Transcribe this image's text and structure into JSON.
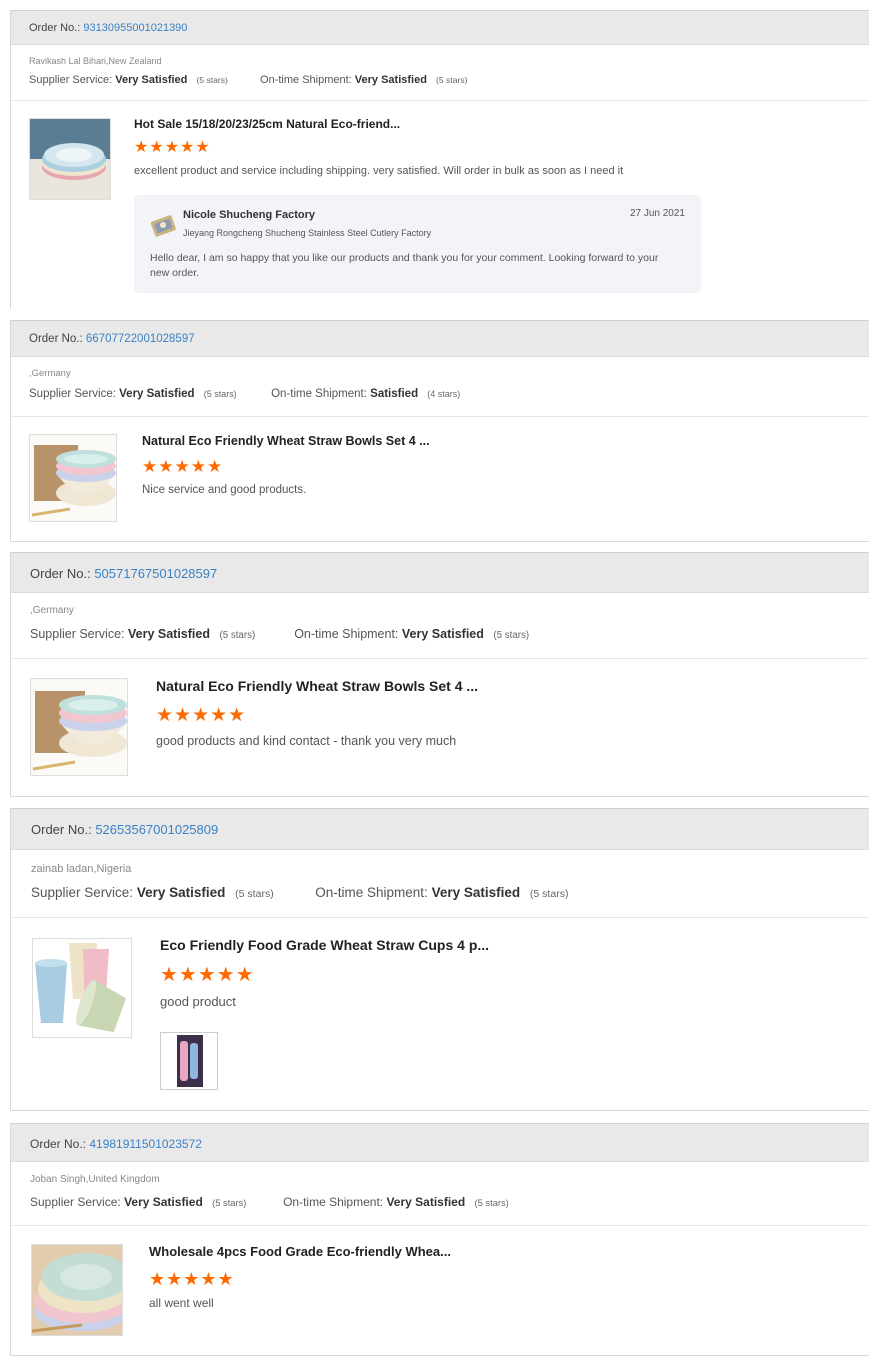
{
  "labels": {
    "order_no": "Order No.:",
    "supplier_service": "Supplier Service:",
    "shipment": "On-time Shipment:"
  },
  "colors": {
    "accent_link": "#3b82c4",
    "star": "#ff6a00",
    "header_bg": "#e9e9e9"
  },
  "orders": [
    {
      "order_no": "93130955001021390",
      "location": "Ravikash Lal Bihari,New Zealand",
      "supplier_rating": "Very Satisfied",
      "supplier_stars": "(5 stars)",
      "shipment_rating": "Very Satisfied",
      "shipment_stars": "(5 stars)",
      "product_title": "Hot Sale 15/18/20/23/25cm Natural Eco-friend...",
      "stars": "★★★★★",
      "rating": 5,
      "comment": "excellent product and service including shipping.  very satisfied. Will order in bulk as soon as I need it",
      "thumb_icon": "plates-stack-image",
      "reply": {
        "name": "Nicole Shucheng Factory",
        "company": "Jieyang Rongcheng Shucheng Stainless Steel Cutlery Factory",
        "date": "27 Jun 2021",
        "text": "Hello dear,  I am so happy that you like our products and thank you for your comment. Looking forward to your new order."
      }
    },
    {
      "order_no": "66707722001028597",
      "location": ",Germany",
      "supplier_rating": "Very Satisfied",
      "supplier_stars": "(5 stars)",
      "shipment_rating": "Satisfied",
      "shipment_stars": "(4 stars)",
      "product_title": "Natural Eco Friendly Wheat Straw Bowls Set 4 ...",
      "stars": "★★★★★",
      "rating": 5,
      "comment": "Nice service and good products.",
      "thumb_icon": "bowls-stack-image"
    },
    {
      "order_no": "50571767501028597",
      "location": ",Germany",
      "supplier_rating": "Very Satisfied",
      "supplier_stars": "(5 stars)",
      "shipment_rating": "Very Satisfied",
      "shipment_stars": "(5 stars)",
      "product_title": "Natural Eco Friendly Wheat Straw Bowls Set 4 ...",
      "stars": "★★★★★",
      "rating": 5,
      "comment": "good products and kind contact - thank you very much",
      "thumb_icon": "bowls-stack-image"
    },
    {
      "order_no": "52653567001025809",
      "location": "zainab ladan,Nigeria",
      "supplier_rating": "Very Satisfied",
      "supplier_stars": "(5 stars)",
      "shipment_rating": "Very Satisfied",
      "shipment_stars": "(5 stars)",
      "product_title": "Eco Friendly Food Grade Wheat Straw Cups 4 p...",
      "stars": "★★★★★",
      "rating": 5,
      "comment": "good product",
      "thumb_icon": "cups-image",
      "review_photo_icon": "customer-photo-cups"
    },
    {
      "order_no": "41981911501023572",
      "location": "Joban Singh,United Kingdom",
      "supplier_rating": "Very Satisfied",
      "supplier_stars": "(5 stars)",
      "shipment_rating": "Very Satisfied",
      "shipment_stars": "(5 stars)",
      "product_title": "Wholesale 4pcs Food Grade Eco-friendly Whea...",
      "stars": "★★★★★",
      "rating": 5,
      "comment": "all went well",
      "thumb_icon": "plates-fan-image"
    }
  ]
}
